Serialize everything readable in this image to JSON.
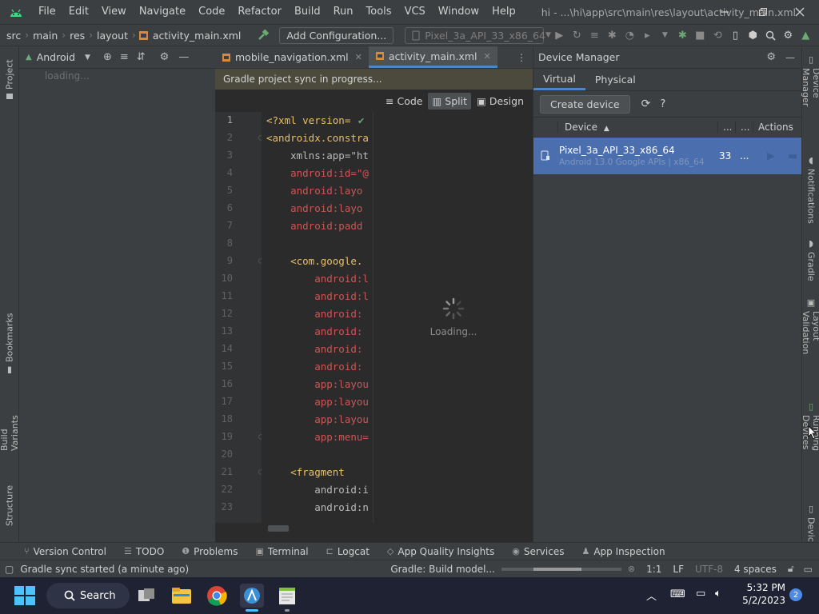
{
  "menubar": {
    "items": [
      "File",
      "Edit",
      "View",
      "Navigate",
      "Code",
      "Refactor",
      "Build",
      "Run",
      "Tools",
      "VCS",
      "Window",
      "Help"
    ],
    "title": "hi - ...\\hi\\app\\src\\main\\res\\layout\\activity_main.xml"
  },
  "navbar": {
    "breadcrumbs": [
      "src",
      "main",
      "res",
      "layout",
      "activity_main.xml"
    ],
    "add_config": "Add Configuration...",
    "device_select": "Pixel_3a_API_33_x86_64"
  },
  "project_panel": {
    "view_label": "Android",
    "loading": "loading..."
  },
  "left_strip": {
    "project": "Project",
    "bookmarks": "Bookmarks",
    "build_variants": "Build Variants",
    "structure": "Structure"
  },
  "editor": {
    "tabs": [
      {
        "label": "mobile_navigation.xml"
      },
      {
        "label": "activity_main.xml"
      }
    ],
    "sync_message": "Gradle project sync in progress...",
    "view_modes": {
      "code": "Code",
      "split": "Split",
      "design": "Design"
    },
    "line_numbers": [
      "1",
      "2",
      "3",
      "4",
      "5",
      "6",
      "7",
      "8",
      "9",
      "10",
      "11",
      "12",
      "13",
      "14",
      "15",
      "16",
      "17",
      "18",
      "19",
      "20",
      "21",
      "22",
      "23"
    ],
    "code_lines": [
      "<?xml version=",
      "<androidx.constra",
      "    xmlns:app=\"ht",
      "    android:id=\"@",
      "    android:layo",
      "    android:layo",
      "    android:padd",
      "",
      "    <com.google.",
      "        android:l",
      "        android:l",
      "        android:",
      "        android:",
      "        android:",
      "        android:",
      "        app:layou",
      "        app:layou",
      "        app:layou",
      "        app:menu=",
      "",
      "    <fragment",
      "        android:i",
      "        android:n"
    ],
    "preview_loading": "Loading..."
  },
  "device_manager": {
    "title": "Device Manager",
    "tabs": [
      "Virtual",
      "Physical"
    ],
    "create_device": "Create device",
    "columns": {
      "device": "Device",
      "more1": "...",
      "more2": "...",
      "actions": "Actions"
    },
    "devices": [
      {
        "name": "Pixel_3a_API_33_x86_64",
        "detail": "Android 13.0 Google APIs | x86_64",
        "api": "33",
        "more": "..."
      }
    ]
  },
  "right_strip": {
    "device_manager": "Device Manager",
    "notifications": "Notifications",
    "gradle": "Gradle",
    "layout_validation": "Layout Validation",
    "running_devices": "Running Devices",
    "device_file": "Device"
  },
  "tool_windows": [
    "Version Control",
    "TODO",
    "Problems",
    "Terminal",
    "Logcat",
    "App Quality Insights",
    "Services",
    "App Inspection"
  ],
  "status": {
    "message": "Gradle sync started (a minute ago)",
    "build": "Gradle: Build model...",
    "position": "1:1",
    "line_sep": "LF",
    "encoding": "UTF-8",
    "indent": "4 spaces"
  },
  "taskbar": {
    "search": "Search",
    "time": "5:32 PM",
    "date": "5/2/2023",
    "notification_count": "2"
  },
  "colors": {
    "selection": "#4b6eaf",
    "accent": "#4a88c7",
    "sync_bar": "#4b4a3c"
  }
}
